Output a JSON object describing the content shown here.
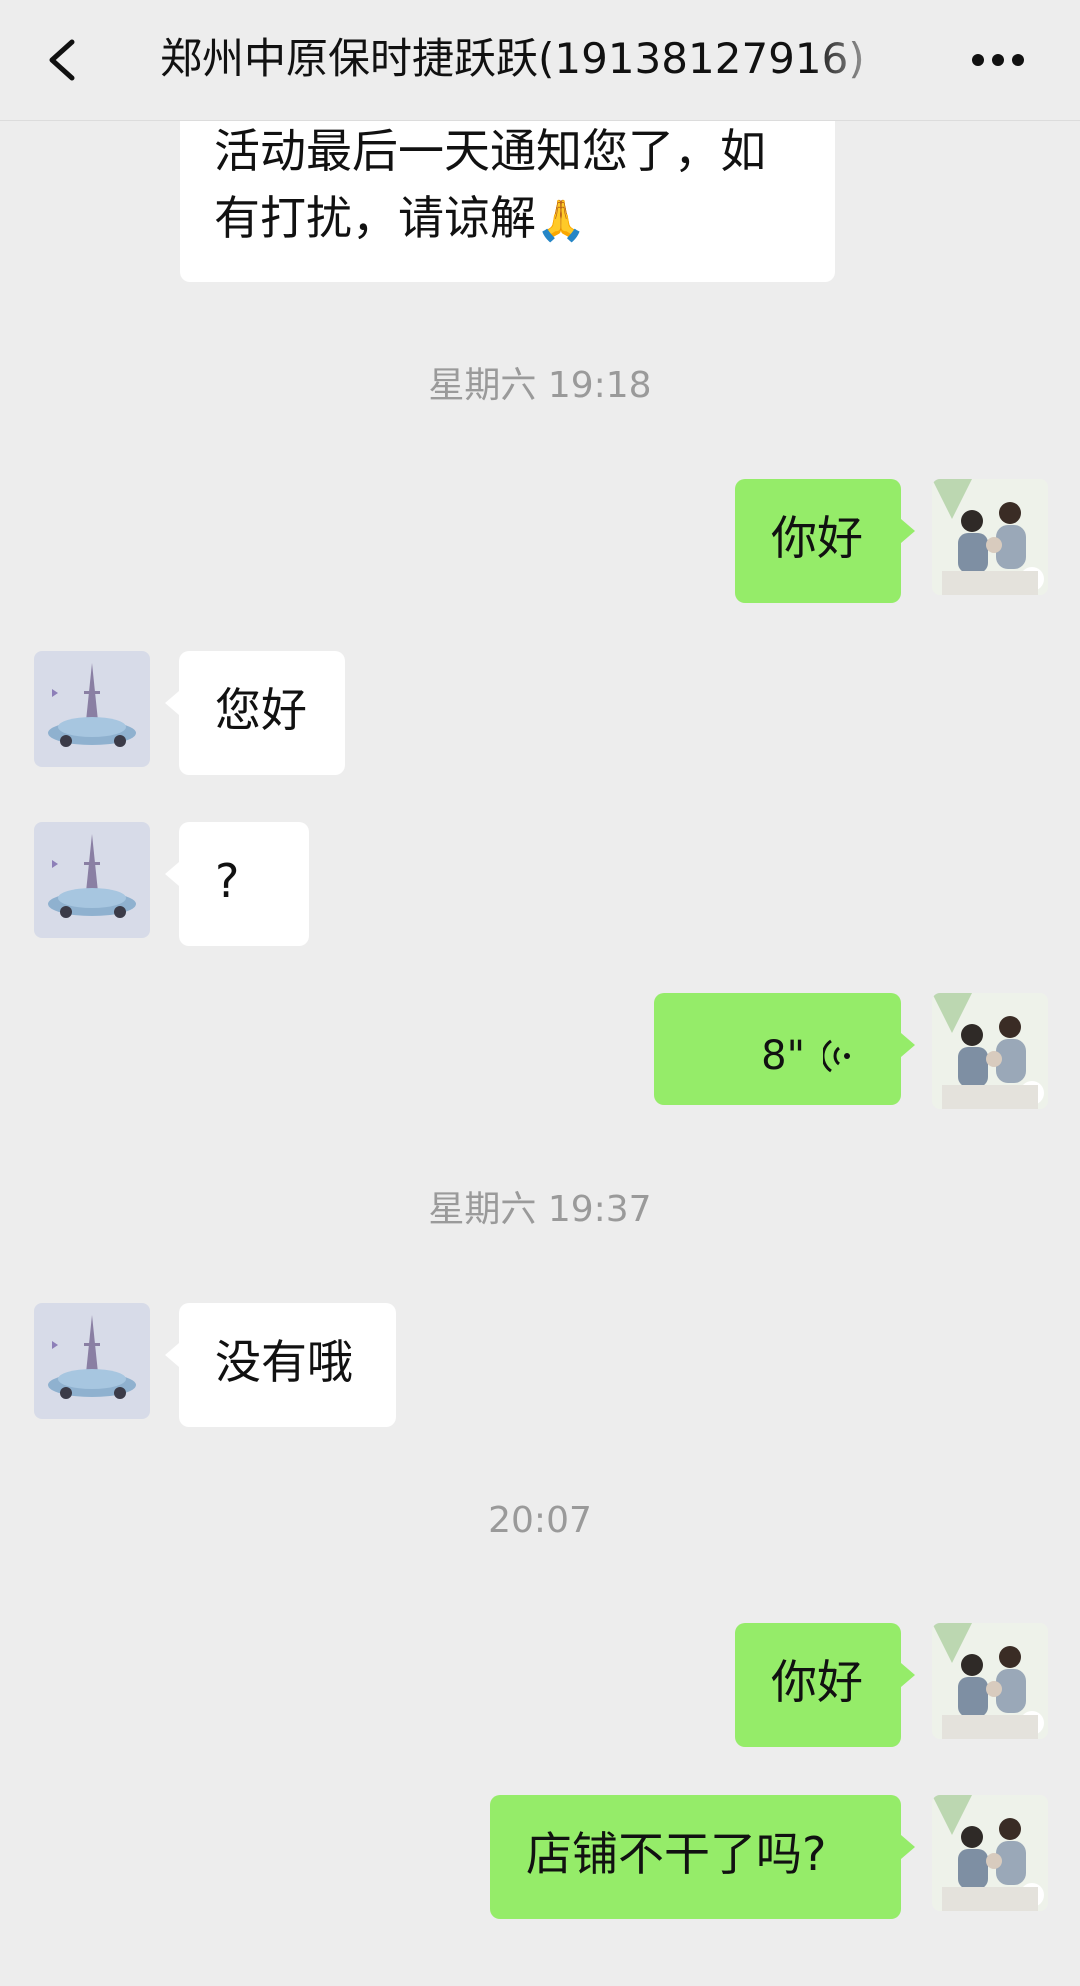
{
  "header": {
    "title": "郑州中原保时捷跃跃(19138127916)",
    "back_icon": "chevron-left-icon",
    "more_icon": "more-dots-icon"
  },
  "messages": {
    "m0_line1": "活动最后一天通知您了，如",
    "m0_line2": "有打扰，请谅解",
    "m0_emoji": "🙏",
    "ts1": "星期六 19:18",
    "m1": "你好",
    "m2": "您好",
    "m3": "?",
    "m4_duration": "8\"",
    "ts2": "星期六 19:37",
    "m5": "没有哦",
    "ts3": "20:07",
    "m6": "你好",
    "m7": "店铺不干了吗?"
  },
  "colors": {
    "background": "#ededed",
    "outgoing_bubble": "#95ec69",
    "incoming_bubble": "#ffffff",
    "timestamp": "#9a9a9a"
  }
}
